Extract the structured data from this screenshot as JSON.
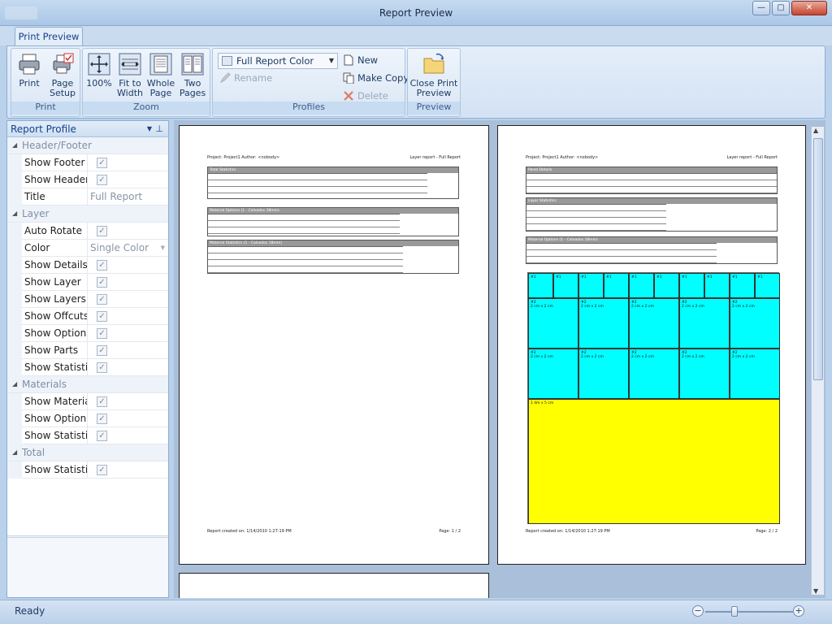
{
  "window": {
    "title": "Report Preview",
    "buttons": {
      "minimize": "—",
      "maximize": "▢",
      "close": "✕"
    }
  },
  "ribbon": {
    "tab": "Print Preview",
    "groups": {
      "print": {
        "label": "Print",
        "print_button": "Print",
        "page_setup_line1": "Page",
        "page_setup_line2": "Setup"
      },
      "zoom": {
        "label": "Zoom",
        "zoom100": "100%",
        "fit_width_line1": "Fit to",
        "fit_width_line2": "Width",
        "whole_page_line1": "Whole",
        "whole_page_line2": "Page",
        "two_pages_line1": "Two",
        "two_pages_line2": "Pages"
      },
      "profiles": {
        "label": "Profiles",
        "selected_profile": "Full Report Color",
        "rename": "Rename",
        "new": "New",
        "make_copy": "Make Copy",
        "delete": "Delete"
      },
      "preview": {
        "label": "Preview",
        "close_line1": "Close Print",
        "close_line2": "Preview"
      }
    }
  },
  "report_profile": {
    "title": "Report Profile",
    "categories": [
      {
        "name": "Header/Footer",
        "rows": [
          {
            "name": "Show Footer",
            "type": "check",
            "checked": true
          },
          {
            "name": "Show Header",
            "type": "check",
            "checked": true
          },
          {
            "name": "Title",
            "type": "text",
            "value": "Full Report"
          }
        ]
      },
      {
        "name": "Layer",
        "rows": [
          {
            "name": "Auto Rotate",
            "type": "check",
            "checked": true
          },
          {
            "name": "Color",
            "type": "select",
            "value": "Single Color"
          },
          {
            "name": "Show Details",
            "type": "check",
            "checked": true
          },
          {
            "name": "Show Layer",
            "type": "check",
            "checked": true
          },
          {
            "name": "Show Layers",
            "type": "check",
            "checked": true
          },
          {
            "name": "Show Offcuts",
            "type": "check",
            "checked": true
          },
          {
            "name": "Show Options",
            "type": "check",
            "checked": true
          },
          {
            "name": "Show Parts",
            "type": "check",
            "checked": true
          },
          {
            "name": "Show Statistics",
            "type": "check",
            "checked": true
          }
        ]
      },
      {
        "name": "Materials",
        "rows": [
          {
            "name": "Show Material",
            "type": "check",
            "checked": true
          },
          {
            "name": "Show Option",
            "type": "check",
            "checked": true
          },
          {
            "name": "Show Statistics",
            "type": "check",
            "checked": true
          }
        ]
      },
      {
        "name": "Total",
        "rows": [
          {
            "name": "Show Statistics",
            "type": "check",
            "checked": true
          }
        ]
      }
    ]
  },
  "pages": [
    {
      "header_left": "Project: Project1 Author: <nobody>",
      "header_right": "Layer report - Full Report",
      "sections": [
        "Total Statistics",
        "Material Options (1 - Calvados 18mm)",
        "Material Statistics (1 - Calvados 18mm)"
      ],
      "footer_left": "Report created on: 1/14/2010 1:27:19 PM",
      "footer_right": "Page: 1 / 2"
    },
    {
      "header_left": "Project: Project1 Author: <nobody>",
      "header_right": "Layer report - Full Report",
      "sections": [
        "Panel Details",
        "Layer Statistics",
        "Material Options (1 - Calvados 18mm)"
      ],
      "layout_top_labels": [
        "#1",
        "#1",
        "#1",
        "#1",
        "#1",
        "#1",
        "#1",
        "#1",
        "#1",
        "#1"
      ],
      "layout_mid_labels": [
        "#2",
        "2 cm x 2 cm"
      ],
      "layout_offcut_label": "1 dm x 5 cm",
      "footer_left": "Report created on: 1/14/2010 1:27:19 PM",
      "footer_right": "Page: 2 / 2"
    }
  ],
  "status": {
    "text": "Ready",
    "zoom_minus": "−",
    "zoom_plus": "+"
  }
}
